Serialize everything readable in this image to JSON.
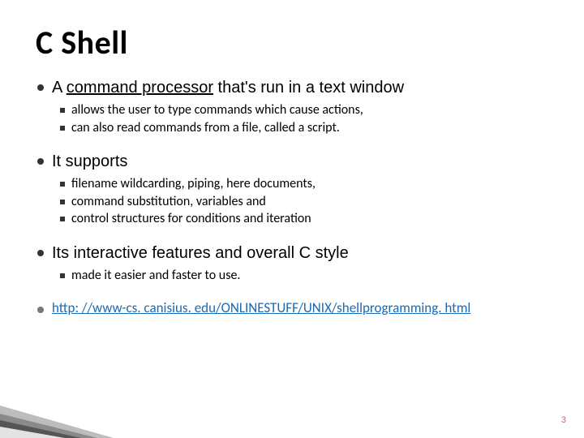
{
  "title": "C Shell",
  "bullets": [
    {
      "prefix": "A ",
      "underlined": "command processor",
      "suffix": " that's run in a text window",
      "sub": [
        "allows the user to type commands which cause actions,",
        "can also read commands from a file, called a script."
      ]
    },
    {
      "prefix": "It supports",
      "underlined": "",
      "suffix": "",
      "sub": [
        "filename wildcarding, piping, here documents,",
        "command substitution, variables and",
        "control structures for conditions and iteration"
      ]
    },
    {
      "prefix": "Its interactive features and overall C style",
      "underlined": "",
      "suffix": "",
      "sub": [
        "made it easier and faster to use."
      ]
    }
  ],
  "link": "http: //www-cs. canisius. edu/ONLINESTUFF/UNIX/shellprogramming. html",
  "page_number": "3"
}
